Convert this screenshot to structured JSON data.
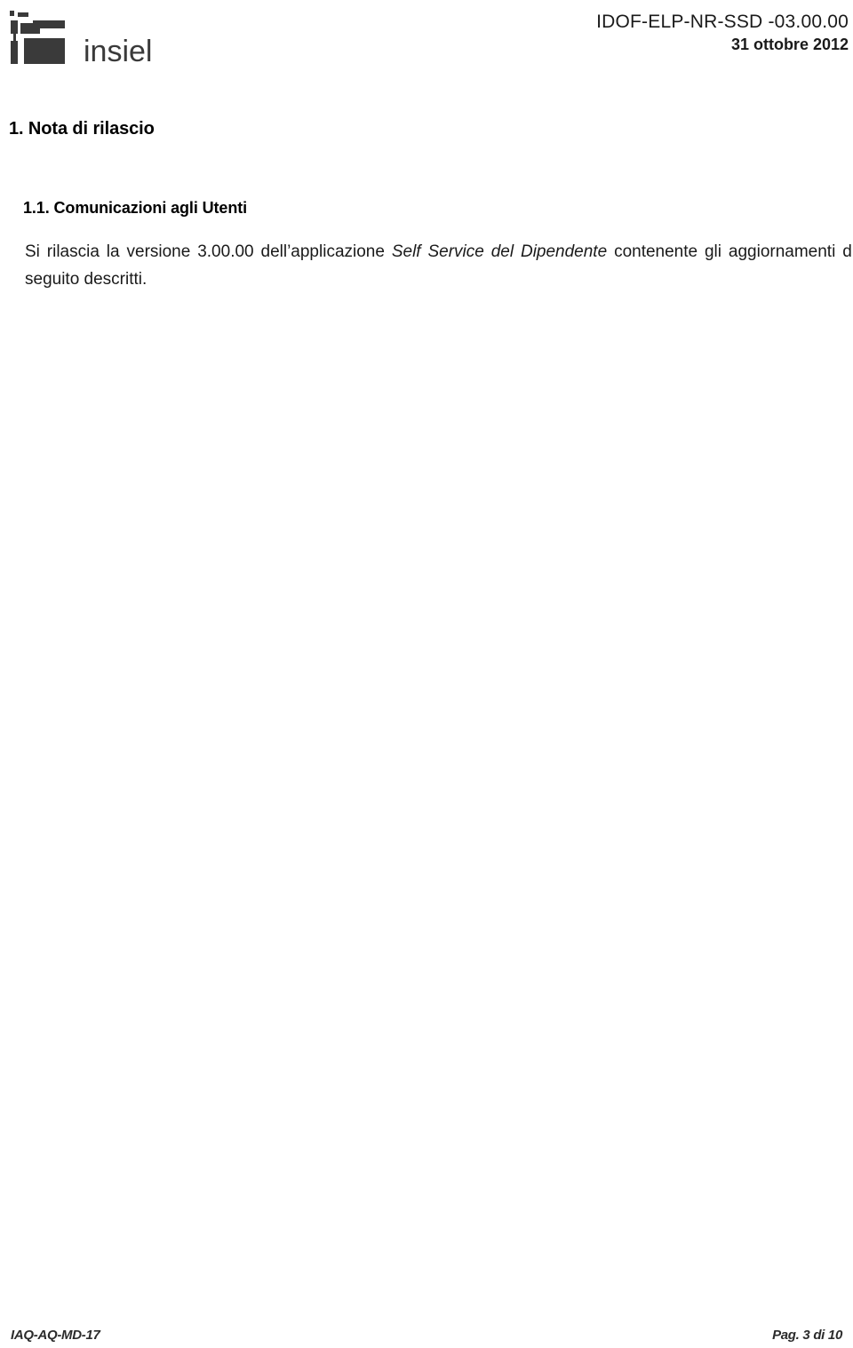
{
  "header": {
    "logo": {
      "mark_icon": "insiel-pixel-mark-icon",
      "wordmark": "insiel"
    },
    "document_code": "IDOF-ELP-NR-SSD -03.00.00",
    "document_date": "31 ottobre 2012"
  },
  "content": {
    "heading1": "1. Nota di rilascio",
    "heading2": "1.1. Comunicazioni agli Utenti",
    "paragraph": {
      "part1": "Si rilascia la versione 3.00.00 dell’applicazione ",
      "emphasis": "Self Service del Dipendente",
      "part2": " contenente gli aggiornamenti di seguito descritti."
    }
  },
  "footer": {
    "form_code": "IAQ-AQ-MD-17",
    "page_label": "Pag. 3 di 10"
  },
  "colors": {
    "logo": "#3a3a3a",
    "text": "#1a1a1a",
    "heading": "#000000",
    "footer": "#2b2b2b",
    "page_background": "#ffffff"
  }
}
